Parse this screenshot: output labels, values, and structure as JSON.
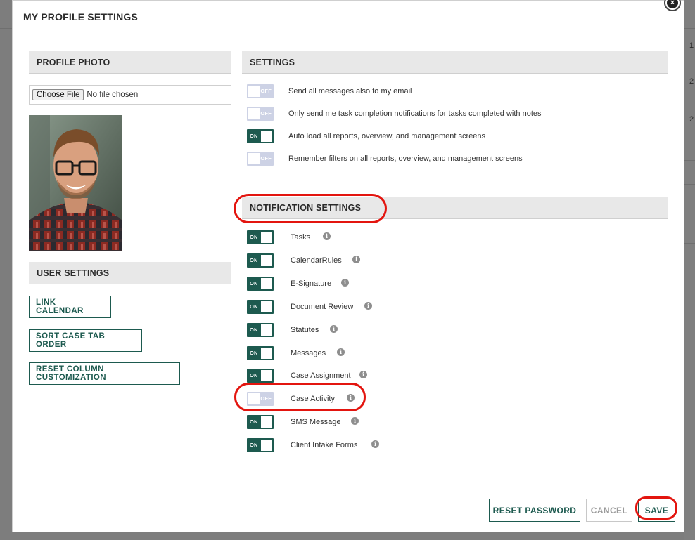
{
  "modal": {
    "title": "MY PROFILE SETTINGS"
  },
  "background": {
    "digits": [
      "1",
      "2",
      "2"
    ]
  },
  "profile_photo": {
    "section_title": "PROFILE PHOTO",
    "choose_file_label": "Choose File",
    "file_status": "No file chosen"
  },
  "user_settings": {
    "section_title": "USER SETTINGS",
    "buttons": [
      "LINK CALENDAR",
      "SORT CASE TAB ORDER",
      "RESET COLUMN CUSTOMIZATION"
    ]
  },
  "settings": {
    "section_title": "SETTINGS",
    "items": [
      {
        "label": "Send all messages also to my email",
        "state": "OFF"
      },
      {
        "label": "Only send me task completion notifications for tasks completed with notes",
        "state": "OFF"
      },
      {
        "label": "Auto load all reports, overview, and management screens",
        "state": "ON"
      },
      {
        "label": "Remember filters on all reports, overview, and management screens",
        "state": "OFF"
      }
    ]
  },
  "notification_settings": {
    "section_title": "NOTIFICATION SETTINGS",
    "items": [
      {
        "label": "Tasks",
        "state": "ON"
      },
      {
        "label": "CalendarRules",
        "state": "ON"
      },
      {
        "label": "E-Signature",
        "state": "ON"
      },
      {
        "label": "Document Review",
        "state": "ON"
      },
      {
        "label": "Statutes",
        "state": "ON"
      },
      {
        "label": "Messages",
        "state": "ON"
      },
      {
        "label": "Case Assignment",
        "state": "ON"
      },
      {
        "label": "Case Activity",
        "state": "OFF"
      },
      {
        "label": "SMS Message",
        "state": "ON"
      },
      {
        "label": "Client Intake Forms",
        "state": "ON"
      }
    ]
  },
  "footer": {
    "reset_password": "RESET PASSWORD",
    "cancel": "CANCEL",
    "save": "SAVE"
  },
  "icons": {
    "info": "info-icon",
    "close": "close-icon"
  },
  "colors": {
    "accent": "#1d5a4f",
    "toggle_off": "#cdd2e5",
    "highlight": "#e3150f"
  }
}
